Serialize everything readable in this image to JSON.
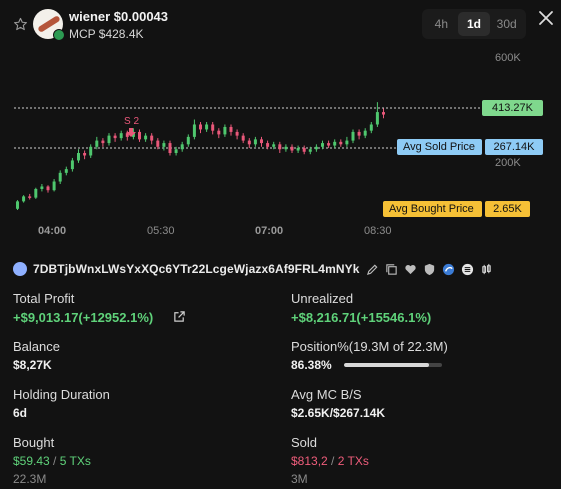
{
  "header": {
    "token_title": "wiener $0.00043",
    "market_cap": "MCP $428.4K",
    "timeframes": [
      {
        "label": "4h",
        "active": false
      },
      {
        "label": "1d",
        "active": true
      },
      {
        "label": "30d",
        "active": false
      }
    ],
    "icons": {
      "favorite": "star-icon",
      "close": "close-icon"
    }
  },
  "chart_data": {
    "type": "candlestick",
    "x_ticks": [
      "04:00",
      "05:30",
      "07:00",
      "08:30"
    ],
    "y_ticks": [
      "600K",
      "200K"
    ],
    "price_labels": {
      "current": "413.27K",
      "avg_sold_label": "Avg Sold Price",
      "avg_sold_value": "267.14K",
      "avg_bought_label": "Avg Bought Price",
      "avg_bought_value": "2.65K"
    },
    "marker": "S 2",
    "colors": {
      "up": "#4fc76e",
      "down": "#e9587a",
      "sold_tag": "#8ecbf5",
      "bought_tag": "#f5c036",
      "current_tag": "#7fd88d"
    },
    "candles": [
      [
        60,
        72,
        58,
        74
      ],
      [
        72,
        80,
        70,
        82
      ],
      [
        80,
        78,
        75,
        84
      ],
      [
        78,
        92,
        76,
        94
      ],
      [
        92,
        96,
        88,
        100
      ],
      [
        96,
        90,
        86,
        98
      ],
      [
        90,
        104,
        88,
        108
      ],
      [
        104,
        118,
        100,
        122
      ],
      [
        118,
        124,
        114,
        128
      ],
      [
        124,
        138,
        120,
        142
      ],
      [
        138,
        150,
        134,
        156
      ],
      [
        150,
        146,
        140,
        154
      ],
      [
        146,
        160,
        142,
        164
      ],
      [
        160,
        170,
        156,
        176
      ],
      [
        170,
        166,
        160,
        174
      ],
      [
        166,
        178,
        162,
        182
      ],
      [
        178,
        174,
        168,
        182
      ],
      [
        174,
        182,
        170,
        186
      ],
      [
        182,
        176,
        170,
        186
      ],
      [
        176,
        184,
        172,
        190
      ],
      [
        184,
        172,
        168,
        188
      ],
      [
        172,
        178,
        168,
        182
      ],
      [
        178,
        170,
        164,
        182
      ],
      [
        170,
        160,
        156,
        174
      ],
      [
        160,
        166,
        154,
        170
      ],
      [
        166,
        150,
        146,
        170
      ],
      [
        150,
        156,
        146,
        160
      ],
      [
        156,
        164,
        152,
        168
      ],
      [
        164,
        176,
        160,
        180
      ],
      [
        176,
        196,
        172,
        204
      ],
      [
        196,
        188,
        182,
        200
      ],
      [
        188,
        196,
        184,
        200
      ],
      [
        196,
        186,
        180,
        200
      ],
      [
        186,
        180,
        174,
        190
      ],
      [
        180,
        192,
        176,
        196
      ],
      [
        192,
        184,
        178,
        196
      ],
      [
        184,
        178,
        172,
        188
      ],
      [
        178,
        170,
        166,
        182
      ],
      [
        170,
        164,
        158,
        174
      ],
      [
        164,
        172,
        160,
        176
      ],
      [
        172,
        166,
        160,
        176
      ],
      [
        166,
        160,
        156,
        170
      ],
      [
        160,
        164,
        156,
        168
      ],
      [
        164,
        156,
        150,
        168
      ],
      [
        156,
        160,
        152,
        164
      ],
      [
        160,
        154,
        150,
        164
      ],
      [
        154,
        158,
        150,
        162
      ],
      [
        158,
        152,
        148,
        162
      ],
      [
        152,
        156,
        148,
        160
      ],
      [
        156,
        160,
        152,
        164
      ],
      [
        160,
        166,
        156,
        170
      ],
      [
        166,
        162,
        158,
        170
      ],
      [
        162,
        168,
        158,
        172
      ],
      [
        168,
        164,
        160,
        172
      ],
      [
        164,
        170,
        160,
        176
      ],
      [
        170,
        184,
        166,
        188
      ],
      [
        184,
        178,
        172,
        188
      ],
      [
        178,
        186,
        174,
        190
      ],
      [
        186,
        196,
        182,
        200
      ],
      [
        196,
        216,
        192,
        232
      ],
      [
        216,
        212,
        206,
        222
      ]
    ]
  },
  "wallet": {
    "address": "7DBTjbWnxLWsYxXQc6YTr22LcgeWjazx6Af9FRL4mNYk",
    "icons": [
      "edit-icon",
      "copy-icon",
      "heart-icon",
      "shield-icon",
      "phantom-icon",
      "list-icon",
      "candle-icon"
    ]
  },
  "stats": {
    "total_profit_label": "Total Profit",
    "total_profit_value": "+$9,013.17(+12952.1%)",
    "unrealized_label": "Unrealized",
    "unrealized_value": "+$8,216.71(+15546.1%)",
    "balance_label": "Balance",
    "balance_value": "$8,27K",
    "position_label": "Position%(19.3M of 22.3M)",
    "position_value": "86.38%",
    "position_fraction": 0.8638,
    "holding_label": "Holding Duration",
    "holding_value": "6d",
    "avg_mc_label": "Avg MC B/S",
    "avg_mc_value": "$2.65K/$267.14K",
    "bought_label": "Bought",
    "bought_amount": "$59.43",
    "bought_txs": "5 TXs",
    "bought_tokens": "22.3M",
    "sold_label": "Sold",
    "sold_amount": "$813,2",
    "sold_txs": "2 TXs",
    "sold_tokens": "3M"
  }
}
